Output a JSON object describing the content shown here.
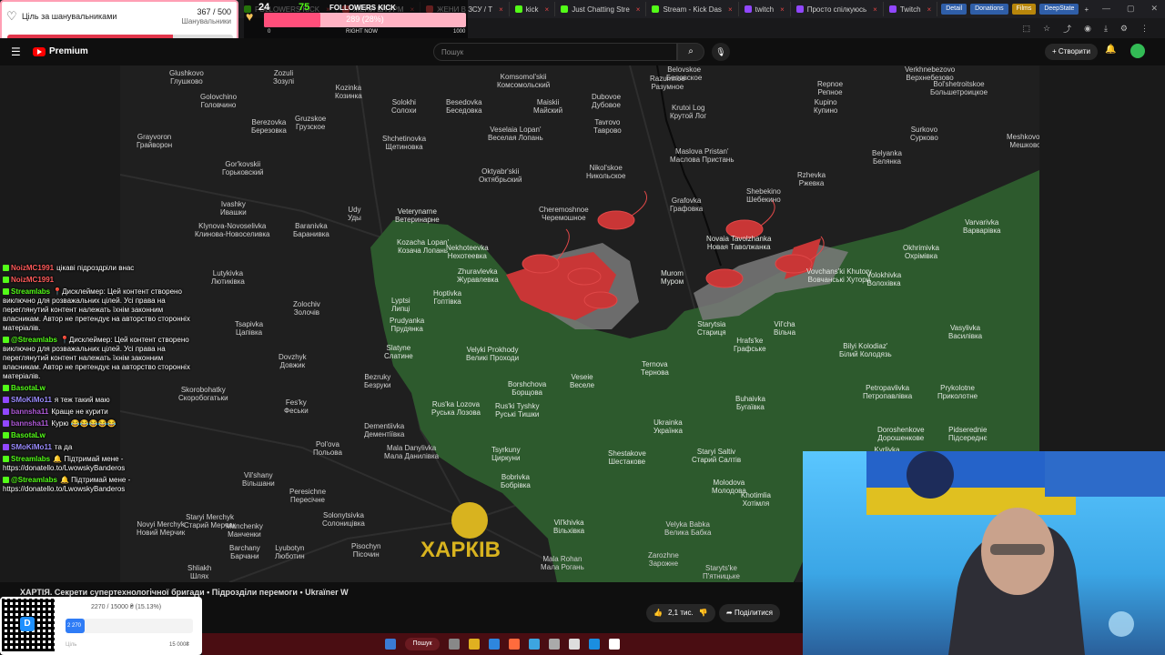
{
  "browser": {
    "tabs": [
      {
        "label": "FOLLOWERS KICK",
        "color": "#53fc18"
      },
      {
        "label": "ЖЕНИ ШТУРМ",
        "color": "#e04545"
      },
      {
        "label": "ЖЕНИ В ЗСУ / Т",
        "color": "#e04545"
      },
      {
        "label": "kick",
        "color": "#53fc18"
      },
      {
        "label": "Just Chatting Stre",
        "color": "#53fc18"
      },
      {
        "label": "Stream - Kick Das",
        "color": "#53fc18"
      },
      {
        "label": "twitch",
        "color": "#9147ff"
      },
      {
        "label": "Просто спілкуюсь",
        "color": "#9147ff"
      },
      {
        "label": "Twitch",
        "color": "#9147ff"
      }
    ],
    "bookmarks": [
      {
        "label": "Detail",
        "color": "#2f5ea8"
      },
      {
        "label": "Donations",
        "color": "#2f5ea8"
      },
      {
        "label": "Films",
        "color": "#b8860b"
      },
      {
        "label": "DeepState",
        "color": "#2f5ea8"
      }
    ],
    "add_tab": "+",
    "window_controls": [
      "—",
      "▢",
      "✕"
    ]
  },
  "fan_goal": {
    "title": "Ціль за шанувальниками",
    "count": "367 / 500",
    "subtitle": "Шанувальники",
    "progress": 0.734
  },
  "kick_followers": {
    "number_left": "24",
    "number_right": "75",
    "label": "FOLLOWERS KICK",
    "bar_text": "289 (28%)",
    "progress": 0.28,
    "tick_min": "0",
    "tick_mid": "RIGHT NOW",
    "tick_max": "1000"
  },
  "youtube": {
    "logo_text": "Premium",
    "search_placeholder": "Пошук",
    "create_label": "+ Створити",
    "video_title": "ХАРТІЯ. Секрети супертехнологічної бригади • Підрозділи перемоги • Ukraïner W",
    "likes": "2,1 тис.",
    "share_label": "Поділитися"
  },
  "map": {
    "city_label": "ХАРКІВ",
    "colors": {
      "bg": "#1f1f1f",
      "territory": "#2d5a2d",
      "contested": "#7a7a7a",
      "enemy": "#c93636",
      "city": "#d8b31f"
    },
    "labels": [
      {
        "name": "Zozuli\nЗозулі",
        "l": 168,
        "t": 4,
        "g": false
      },
      {
        "name": "Golovchino\nГоловчино",
        "l": 88,
        "t": 30,
        "g": false
      },
      {
        "name": "Berezovka\nБерезовка",
        "l": 144,
        "t": 58,
        "g": false
      },
      {
        "name": "Gruzskoe\nГрузское",
        "l": 192,
        "t": 54,
        "g": false
      },
      {
        "name": "Grayvoron\nГрайворон",
        "l": 18,
        "t": 74,
        "g": false
      },
      {
        "name": "Kozinka\nКозинка",
        "l": 236,
        "t": 20,
        "g": false
      },
      {
        "name": "Shchetinovka\nЩетиновка",
        "l": 288,
        "t": 76,
        "g": false
      },
      {
        "name": "Solokhi\nСолохи",
        "l": 298,
        "t": 36,
        "g": false
      },
      {
        "name": "Komsomol'skii\nКомсомольский",
        "l": 414,
        "t": 8,
        "g": false
      },
      {
        "name": "Besedovka\nБеседовка",
        "l": 358,
        "t": 36,
        "g": false
      },
      {
        "name": "Maiskii\nМайский",
        "l": 454,
        "t": 36,
        "g": false
      },
      {
        "name": "Dubovoe\nДубовое",
        "l": 518,
        "t": 30,
        "g": false
      },
      {
        "name": "Razumnoe\nРазумное",
        "l": 582,
        "t": 10,
        "g": false
      },
      {
        "name": "Belovskoe\nБеловское",
        "l": 600,
        "t": 0,
        "g": false
      },
      {
        "name": "Krutoi Log\nКрутой Лог",
        "l": 604,
        "t": 42,
        "g": false
      },
      {
        "name": "Tavrovo\nТаврово",
        "l": 520,
        "t": 58,
        "g": false
      },
      {
        "name": "Veselaia Lopan'\nВеселая Лопань",
        "l": 404,
        "t": 66,
        "g": false
      },
      {
        "name": "Glushkovo\nГлушково",
        "l": 54,
        "t": 4,
        "g": false
      },
      {
        "name": "Gor'kovskii\nГорьковский",
        "l": 112,
        "t": 104,
        "g": false
      },
      {
        "name": "Oktyabr'skii\nОктябрьский",
        "l": 394,
        "t": 112,
        "g": false
      },
      {
        "name": "Nikol'skoe\nНикольское",
        "l": 512,
        "t": 108,
        "g": false
      },
      {
        "name": "Maslova Pristan'\nМаслова Пристань",
        "l": 604,
        "t": 90,
        "g": false
      },
      {
        "name": "Repnoe\nРепное",
        "l": 766,
        "t": 16,
        "g": false
      },
      {
        "name": "Kupino\nКупино",
        "l": 762,
        "t": 36,
        "g": false
      },
      {
        "name": "Verkhnebezovo\nВерхнебезово",
        "l": 862,
        "t": 0,
        "g": false
      },
      {
        "name": "Bol'shetroitskoe\nБольшетроицкое",
        "l": 890,
        "t": 16,
        "g": false
      },
      {
        "name": "Surkovo\nСурково",
        "l": 868,
        "t": 66,
        "g": false
      },
      {
        "name": "Belyanka\nБелянка",
        "l": 826,
        "t": 92,
        "g": false
      },
      {
        "name": "Meshkovoe\nМешково",
        "l": 974,
        "t": 74,
        "g": false
      },
      {
        "name": "Rzhevka\nРжевка",
        "l": 744,
        "t": 116,
        "g": false
      },
      {
        "name": "Shebekino\nШебекино",
        "l": 688,
        "t": 134,
        "g": false
      },
      {
        "name": "Grafovka\nГрафовка",
        "l": 604,
        "t": 144,
        "g": false
      },
      {
        "name": "Udy\nУды",
        "l": 250,
        "t": 154,
        "g": false
      },
      {
        "name": "Ivashky\nИвашки",
        "l": 110,
        "t": 148,
        "g": false
      },
      {
        "name": "Klynova-Novoselivka\nКлинова-Новоселивка",
        "l": 82,
        "t": 172,
        "g": false
      },
      {
        "name": "Baranivka\nБаранивка",
        "l": 190,
        "t": 172,
        "g": false
      },
      {
        "name": "Veterynarne\nВетеринарне",
        "l": 302,
        "t": 156,
        "g": true
      },
      {
        "name": "Cheremoshnoe\nЧеремошное",
        "l": 460,
        "t": 154,
        "g": false
      },
      {
        "name": "Kozacha Lopan'\nКозача Лопань",
        "l": 304,
        "t": 190,
        "g": true
      },
      {
        "name": "Nekhoteevka\nНехотеевка",
        "l": 358,
        "t": 196,
        "g": true
      },
      {
        "name": "Zhuravlevka\nЖуравлевка",
        "l": 370,
        "t": 222,
        "g": true
      },
      {
        "name": "Murom\nМуром",
        "l": 594,
        "t": 224,
        "g": true
      },
      {
        "name": "Novaia Tavolzhanka\nНовая Таволжанка",
        "l": 644,
        "t": 186,
        "g": true
      },
      {
        "name": "Okhrimivka\nОхрімівка",
        "l": 860,
        "t": 196,
        "g": true
      },
      {
        "name": "Varvarivka\nВарварівка",
        "l": 926,
        "t": 168,
        "g": true
      },
      {
        "name": "Vovchans'ki Khutory\nВовчанські Хутори",
        "l": 754,
        "t": 222,
        "g": true
      },
      {
        "name": "Volokhivka\nВолохівка",
        "l": 820,
        "t": 226,
        "g": true
      },
      {
        "name": "Lyptsi\nЛипці",
        "l": 298,
        "t": 254,
        "g": true
      },
      {
        "name": "Hoptivka\nГоптівка",
        "l": 344,
        "t": 246,
        "g": true
      },
      {
        "name": "Lutykivka\nЛютиківка",
        "l": 100,
        "t": 224,
        "g": false
      },
      {
        "name": "Zolochiv\nЗолочів",
        "l": 190,
        "t": 258,
        "g": false
      },
      {
        "name": "Tsapivka\nЦапівка",
        "l": 126,
        "t": 280,
        "g": false
      },
      {
        "name": "Prudyanka\nПрудянка",
        "l": 296,
        "t": 276,
        "g": true
      },
      {
        "name": "Starytsia\nСтариця",
        "l": 634,
        "t": 280,
        "g": true
      },
      {
        "name": "Vil'cha\nВільча",
        "l": 718,
        "t": 280,
        "g": true
      },
      {
        "name": "Hrafs'ke\nГрафське",
        "l": 674,
        "t": 298,
        "g": true
      },
      {
        "name": "Vasylivka\nВасилівка",
        "l": 910,
        "t": 284,
        "g": true
      },
      {
        "name": "Slatyne\nСлатине",
        "l": 290,
        "t": 306,
        "g": true
      },
      {
        "name": "Velyki Prokhody\nВеликі Проходи",
        "l": 380,
        "t": 308,
        "g": true
      },
      {
        "name": "Dovzhyk\nДовжик",
        "l": 174,
        "t": 316,
        "g": false
      },
      {
        "name": "Bilyi Kolodiaz'\nБілий Колодязь",
        "l": 790,
        "t": 304,
        "g": true
      },
      {
        "name": "Ternova\nТернова",
        "l": 572,
        "t": 324,
        "g": true
      },
      {
        "name": "Bezruky\nБезруки",
        "l": 268,
        "t": 338,
        "g": false
      },
      {
        "name": "Veseie\nВеселе",
        "l": 494,
        "t": 338,
        "g": true
      },
      {
        "name": "Borshchova\nБорщова",
        "l": 426,
        "t": 346,
        "g": true
      },
      {
        "name": "Skorobohatky\nСкоробогатьки",
        "l": 64,
        "t": 352,
        "g": false
      },
      {
        "name": "Petropavlivka\nПетропавлівка",
        "l": 816,
        "t": 350,
        "g": true
      },
      {
        "name": "Prykolotne\nПриколотне",
        "l": 898,
        "t": 350,
        "g": true
      },
      {
        "name": "Fes'ky\nФеськи",
        "l": 180,
        "t": 366,
        "g": false
      },
      {
        "name": "Rus'ka Lozova\nРуська Лозова",
        "l": 342,
        "t": 368,
        "g": true
      },
      {
        "name": "Rus'ki Tyshky\nРуські Тишки",
        "l": 412,
        "t": 370,
        "g": true
      },
      {
        "name": "Buhaivka\nБугаївка",
        "l": 676,
        "t": 362,
        "g": true
      },
      {
        "name": "Ukrainka\nУкраїнка",
        "l": 586,
        "t": 388,
        "g": true
      },
      {
        "name": "Dementiivka\nДементіївка",
        "l": 268,
        "t": 392,
        "g": false
      },
      {
        "name": "Doroshenkove\nДорошенкове",
        "l": 832,
        "t": 396,
        "g": true
      },
      {
        "name": "Pidserednie\nПідсереднє",
        "l": 910,
        "t": 396,
        "g": true
      },
      {
        "name": "Pol'ova\nПольова",
        "l": 212,
        "t": 412,
        "g": false
      },
      {
        "name": "Mala Danylivka\nМала Данилівка",
        "l": 290,
        "t": 416,
        "g": false
      },
      {
        "name": "Tsyrkuny\nЦиркуни",
        "l": 408,
        "t": 418,
        "g": true
      },
      {
        "name": "Shestakove\nШестакове",
        "l": 536,
        "t": 422,
        "g": true
      },
      {
        "name": "Staryi Saltiv\nСтарий Салтів",
        "l": 628,
        "t": 420,
        "g": true
      },
      {
        "name": "Kyrlivka\nКирилівка",
        "l": 824,
        "t": 418,
        "g": true
      },
      {
        "name": "Vil'shany\nВільшани",
        "l": 134,
        "t": 446,
        "g": false
      },
      {
        "name": "Bobrivka\nБобрівка",
        "l": 418,
        "t": 448,
        "g": true
      },
      {
        "name": "Molodova\nМолодова",
        "l": 650,
        "t": 454,
        "g": true
      },
      {
        "name": "Peresichne\nПересічне",
        "l": 186,
        "t": 464,
        "g": false
      },
      {
        "name": "Khotimlia\nХотімля",
        "l": 682,
        "t": 468,
        "g": true
      },
      {
        "name": "Solonytsivka\nСолоницівка",
        "l": 222,
        "t": 490,
        "g": false
      },
      {
        "name": "Staryi Merchyk\nСтарий Мерчик",
        "l": 70,
        "t": 492,
        "g": false
      },
      {
        "name": "Manchenky\nМанченки",
        "l": 116,
        "t": 502,
        "g": false
      },
      {
        "name": "Vil'khivka\nВільхівка",
        "l": 476,
        "t": 498,
        "g": true
      },
      {
        "name": "Velyka Babka\nВелика Бабка",
        "l": 598,
        "t": 500,
        "g": false
      },
      {
        "name": "Barchany\nБарчани",
        "l": 120,
        "t": 526,
        "g": false
      },
      {
        "name": "Lyubotyn\nЛюботин",
        "l": 170,
        "t": 526,
        "g": false
      },
      {
        "name": "Pisochyn\nПісочин",
        "l": 254,
        "t": 524,
        "g": false
      },
      {
        "name": "Mala Rohan\nМала Рогань",
        "l": 462,
        "t": 538,
        "g": false
      },
      {
        "name": "Zarozhne\nЗарожне",
        "l": 580,
        "t": 534,
        "g": false
      },
      {
        "name": "Staryts'ke\nП'ятницьке",
        "l": 640,
        "t": 548,
        "g": false
      },
      {
        "name": "Shliakh\nШлях",
        "l": 74,
        "t": 548,
        "g": false
      },
      {
        "name": "Novyi Merchyk\nНовий Мерчик",
        "l": 18,
        "t": 500,
        "g": false
      }
    ]
  },
  "chat": [
    {
      "user": "NoizMC1991",
      "user_color": "#ff5a5a",
      "platform": "kick",
      "text": "цікаві підроздріли внас"
    },
    {
      "user": "NoizMC1991",
      "user_color": "#ff5a5a",
      "platform": "kick",
      "text": ""
    },
    {
      "user": "Streamlabs",
      "user_color": "#53fc18",
      "platform": "kick",
      "text": "📍Дисклеймер: Цей контент створено виключно для розважальних цілей. Усі права на переглянутий контент належать їхнім законним власникам. Автор не претендує на авторство сторонніх матеріалів."
    },
    {
      "user": "@Streamlabs",
      "user_color": "#53fc18",
      "platform": "kick",
      "text": "📍Дисклеймер: Цей контент створено виключно для розважальних цілей. Усі права на переглянутий контент належать їхнім законним власникам. Автор не претендує на авторство сторонніх матеріалів."
    },
    {
      "user": "BasotaLw",
      "user_color": "#53fc18",
      "platform": "kick",
      "text": ""
    },
    {
      "user": "SMoKiMo11",
      "user_color": "#9b8cff",
      "platform": "twitch",
      "text": "я теж такий маю"
    },
    {
      "user": "bannsha11",
      "user_color": "#b05ad8",
      "platform": "twitch",
      "text": "Краще не курити"
    },
    {
      "user": "bannsha11",
      "user_color": "#b05ad8",
      "platform": "twitch",
      "text": "Курю 😂😂😂😂😂"
    },
    {
      "user": "BasotaLw",
      "user_color": "#53fc18",
      "platform": "kick",
      "text": ""
    },
    {
      "user": "SMoKiMo11",
      "user_color": "#9b8cff",
      "platform": "twitch",
      "text": "та да"
    },
    {
      "user": "Streamlabs",
      "user_color": "#53fc18",
      "platform": "kick",
      "text": "🔔 Підтримай мене - https://donatello.to/LwowskyBanderos"
    },
    {
      "user": "@Streamlabs",
      "user_color": "#53fc18",
      "platform": "kick",
      "text": "🔔 Підтримай мене - https://donatello.to/LwowskyBanderos"
    }
  ],
  "donation": {
    "progress_text": "2270 / 15000 ₴ (15.13%)",
    "bar_label": "2 270",
    "progress": 0.1513,
    "goal_min": "Ціль",
    "goal_max": "15 000₴"
  },
  "taskbar": {
    "search_label": "Пошук"
  }
}
